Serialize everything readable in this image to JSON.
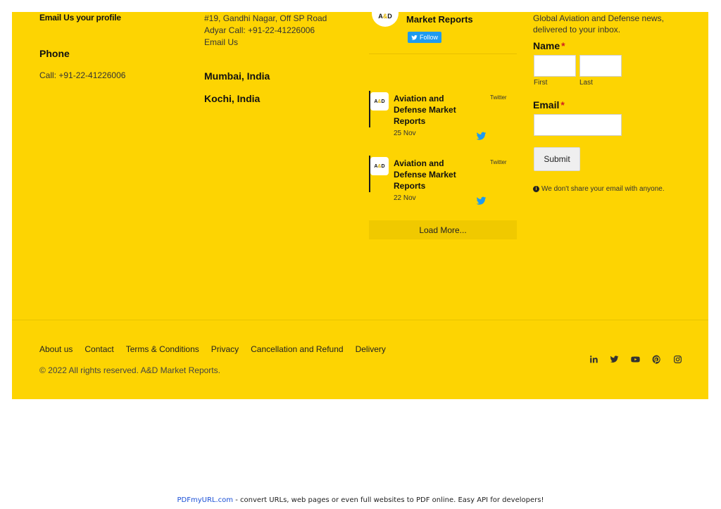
{
  "contact": {
    "email_label": "Email Us your profile",
    "phone_heading": "Phone",
    "phone_value": "Call: +91-22-41226006"
  },
  "offices": {
    "address_line1": "#19, Gandhi Nagar, Off SP Road",
    "address_line2": "Adyar Call: +91-22-41226006",
    "email_link": "Email Us",
    "cities": [
      "Mumbai, India",
      "Kochi, India"
    ]
  },
  "twitter": {
    "account_name": "Aviation and Defense Market Reports",
    "avatar_text": [
      "A",
      "&",
      "D"
    ],
    "follow_label": "Follow",
    "tweets": [
      {
        "author": "Aviation and Defense Market Reports",
        "source": "Twitter",
        "date": "25 Nov"
      },
      {
        "author": "Aviation and Defense Market Reports",
        "source": "Twitter",
        "date": "22 Nov"
      }
    ],
    "load_more_label": "Load More..."
  },
  "newsletter": {
    "tagline_line1": "Global Aviation and Defense news,",
    "tagline_line2": "delivered to your inbox.",
    "name_label": "Name",
    "required_mark": "*",
    "first_label": "First",
    "last_label": "Last",
    "email_label": "Email",
    "submit_label": "Submit",
    "privacy_note": "We don't share your email with anyone."
  },
  "bottom": {
    "links": [
      "About us",
      "Contact",
      "Terms & Conditions",
      "Privacy",
      "Cancellation and Refund",
      "Delivery"
    ],
    "copyright": "© 2022 All rights reserved. A&D Market Reports.",
    "social_icons": [
      "linkedin-icon",
      "twitter-icon",
      "youtube-icon",
      "pinterest-icon",
      "instagram-icon"
    ]
  },
  "pdf_banner": {
    "link_text": "PDFmyURL.com",
    "message": " - convert URLs, web pages or even full websites to PDF online. Easy API for developers!"
  },
  "colors": {
    "footer_bg": "#fdd402",
    "twitter_blue": "#1d9bf0",
    "required_red": "#d21f1f"
  }
}
